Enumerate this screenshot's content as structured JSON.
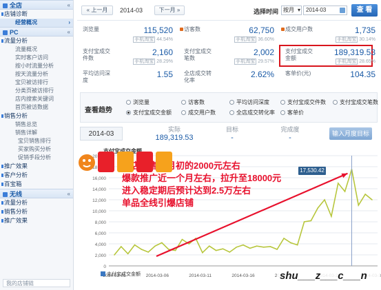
{
  "sidebar": {
    "sections": [
      {
        "title": "全店",
        "toggle": "«",
        "groups": [
          {
            "label": "店铺诊断",
            "items": []
          },
          {
            "label": "",
            "items": [
              {
                "label": "经营概况",
                "active": true
              }
            ]
          }
        ]
      },
      {
        "title": "PC",
        "toggle": "«",
        "groups": [
          {
            "label": "流量分析",
            "items": [
              {
                "label": "流量概况"
              },
              {
                "label": "实时客户访问"
              },
              {
                "label": "按小时流量分析"
              },
              {
                "label": "按天流量分析"
              },
              {
                "label": "宝贝被访排行"
              },
              {
                "label": "分类页被访排行"
              },
              {
                "label": "店内搜索关键词"
              },
              {
                "label": "首页被访数据"
              }
            ]
          },
          {
            "label": "销售分析",
            "items": [
              {
                "label": "销售总览"
              },
              {
                "label": "销售详解"
              },
              {
                "label": "宝贝销售排行",
                "sub": true
              },
              {
                "label": "买家购买分析",
                "sub": true
              },
              {
                "label": "促销手段分析",
                "sub": true
              }
            ]
          },
          {
            "label": "推广效果",
            "items": []
          },
          {
            "label": "客户分析",
            "items": []
          },
          {
            "label": "百宝箱",
            "items": []
          }
        ]
      },
      {
        "title": "无线",
        "toggle": "«",
        "groups": [
          {
            "label": "流量分析",
            "items": []
          },
          {
            "label": "销售分析",
            "items": []
          },
          {
            "label": "推广效果",
            "items": []
          }
        ]
      }
    ],
    "footer": "我的店铺链"
  },
  "datebar": {
    "prev_label": "« 上一月",
    "current": "2014-03",
    "next_label": "下一月 »",
    "select_label": "选择时间",
    "mode": "按月",
    "date_value": "2014-03",
    "view_label": "查 看"
  },
  "metrics": [
    {
      "label": "浏览量",
      "value": "115,520",
      "cmp_tag": "手机淘宝",
      "cmp": "44.54%"
    },
    {
      "label": "访客数",
      "value": "62,750",
      "cmp_tag": "手机淘宝",
      "cmp": "36.60%",
      "icon": true
    },
    {
      "label": "成交用户数",
      "value": "1,735",
      "cmp_tag": "手机淘宝",
      "cmp": "30.14%",
      "icon": true
    },
    {
      "label": "支付宝成交件数",
      "value": "2,160",
      "cmp_tag": "手机淘宝",
      "cmp": "28.29%"
    },
    {
      "label": "支付宝成交笔数",
      "value": "2,002",
      "cmp_tag": "手机淘宝",
      "cmp": "29.57%"
    },
    {
      "label": "支付宝成交金额",
      "value": "189,319.53",
      "cmp_tag": "手机淘宝",
      "cmp": "28.65%"
    },
    {
      "label": "平均访问深度",
      "value": "1.55",
      "cmp_tag": "",
      "cmp": ""
    },
    {
      "label": "全店成交转化率",
      "value": "2.62%",
      "cmp_tag": "",
      "cmp": ""
    },
    {
      "label": "客单价(元)",
      "value": "104.35",
      "cmp_tag": "",
      "cmp": ""
    }
  ],
  "trend": {
    "title": "查看趋势",
    "options": [
      {
        "label": "浏览量",
        "on": false
      },
      {
        "label": "访客数",
        "on": false
      },
      {
        "label": "平均访问深度",
        "on": false
      },
      {
        "label": "支付宝成交件数",
        "on": false
      },
      {
        "label": "支付宝成交笔数",
        "on": false
      },
      {
        "label": "支付宝成交金额",
        "on": true
      },
      {
        "label": "成交用户数",
        "on": false
      },
      {
        "label": "全店成交转化率",
        "on": false
      },
      {
        "label": "客单价",
        "on": false
      }
    ]
  },
  "summary": {
    "month": "2014-03",
    "actual_label": "实际",
    "actual_value": "189,319.53",
    "target_label": "目标",
    "target_value": "-",
    "done_label": "完成度",
    "done_value": "-",
    "target_button": "输入月度目标"
  },
  "chart_data": {
    "type": "line",
    "title": "支付宝成交金额",
    "ylim": [
      0,
      20000
    ],
    "yticks": [
      "20,000",
      "18,000",
      "16,000",
      "14,000",
      "12,000",
      "10,000",
      "8,000",
      "6,000",
      "4,000",
      "2,000",
      "0"
    ],
    "xticks": [
      "2014-03-01",
      "2014-03-06",
      "2014-03-11",
      "2014-03-16",
      "2014-03-21",
      "2014-03-26",
      "2014-03-31"
    ],
    "series": [
      {
        "name": "支付宝成交金额",
        "values": [
          2000,
          3500,
          2200,
          3800,
          3000,
          2500,
          3600,
          4200,
          3000,
          2800,
          4800,
          4000,
          5000,
          2400,
          3600,
          2800,
          3100,
          2500,
          3400,
          3800,
          3200,
          3600,
          3400,
          3500,
          3000,
          5000,
          4200,
          3800,
          8000,
          8200,
          10500,
          12000,
          9000,
          15000,
          13500,
          17530,
          11000,
          13000,
          12000
        ]
      }
    ],
    "tooltip": "17,530.42",
    "color": "#b7c63c"
  },
  "annotation": {
    "lines": [
      "整店销售额月初的2000元左右",
      "爆款推广近一个月左右，拉升至18000元",
      "进入稳定期后预计达到2.5万左右",
      "单品全线引爆店铺"
    ],
    "color": "#e8112d"
  },
  "watermark": {
    "text": "shu___z___c___n"
  }
}
